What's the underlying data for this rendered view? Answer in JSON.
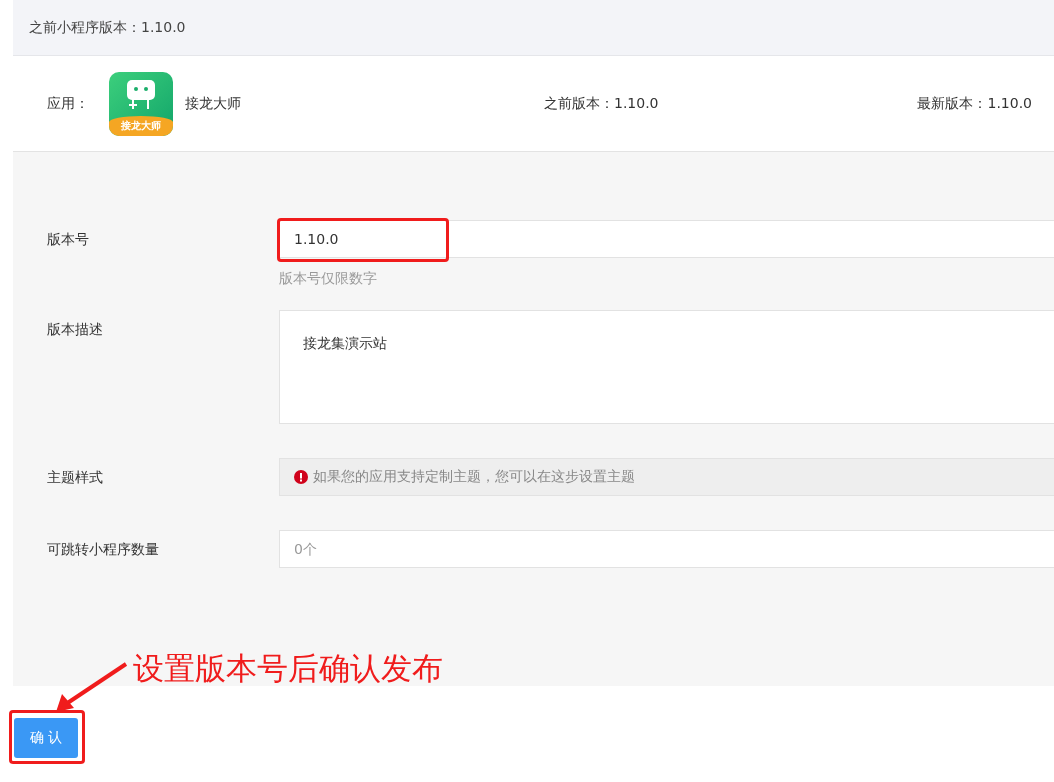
{
  "header": {
    "text": "之前小程序版本：1.10.0"
  },
  "app": {
    "label": "应用：",
    "icon_text": "接龙大师",
    "name": "接龙大师",
    "previous_version": "之前版本：1.10.0",
    "latest_version": "最新版本：1.10.0"
  },
  "form": [
    {
      "kind": "input",
      "label": "版本号",
      "value": "1.10.0",
      "hint": "版本号仅限数字",
      "highlighted": true
    },
    {
      "kind": "textarea",
      "label": "版本描述",
      "value": "接龙集演示站",
      "highlighted": false
    },
    {
      "kind": "notice",
      "label": "主题样式",
      "value": "如果您的应用支持定制主题，您可以在这步设置主题",
      "highlighted": false
    },
    {
      "kind": "count",
      "label": "可跳转小程序数量",
      "placeholder": "0个",
      "highlighted": false
    }
  ],
  "annotation": {
    "text": "设置版本号后确认发布"
  },
  "confirm_button": {
    "label": "确 认",
    "highlighted": true
  }
}
